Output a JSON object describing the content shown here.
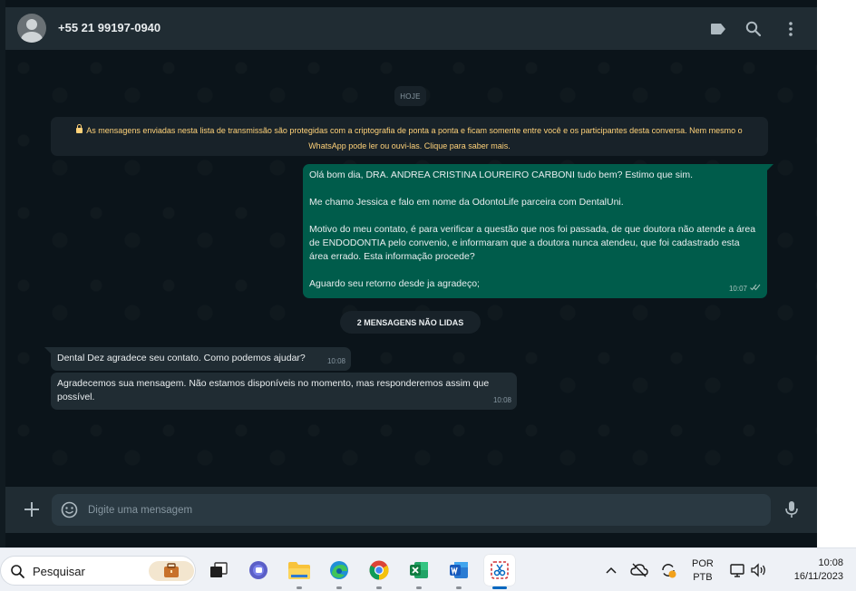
{
  "header": {
    "contact": "+55 21 99197-0940",
    "icons": [
      "label-icon",
      "search-icon",
      "menu-dots-icon"
    ]
  },
  "chat": {
    "date_divider": "HOJE",
    "encryption_notice": "As mensagens enviadas nesta lista de transmissão são protegidas com a criptografia de ponta a ponta e ficam somente entre você e os participantes desta conversa. Nem mesmo o WhatsApp pode ler ou ouvi-las. Clique para saber mais.",
    "outgoing": {
      "paragraphs": [
        "Olá bom dia, DRA. ANDREA CRISTINA LOUREIRO CARBONI tudo bem? Estimo que sim.",
        "Me chamo Jessica e falo em nome da OdontoLife parceira com DentalUni.",
        "Motivo do meu contato, é para verificar a questão que nos foi passada, de que doutora não atende a área de ENDODONTIA pelo convenio, e informaram que a doutora nunca atendeu, que foi cadastrado esta área errado. Esta informação procede?",
        "Aguardo seu retorno desde ja agradeço;"
      ],
      "time": "10:07",
      "status_icon": "double-check-icon"
    },
    "unread_divider": "2 MENSAGENS NÃO LIDAS",
    "incoming": [
      {
        "text": "Dental Dez agradece seu contato. Como podemos ajudar?",
        "time": "10:08"
      },
      {
        "text": "Agradecemos sua mensagem. Não estamos disponíveis no momento, mas responderemos assim que possível.",
        "time": "10:08"
      }
    ]
  },
  "composer": {
    "placeholder": "Digite uma mensagem",
    "icons": [
      "plus-icon",
      "emoji-icon",
      "mic-icon"
    ]
  },
  "taskbar": {
    "search_label": "Pesquisar",
    "apps": [
      "task-view-icon",
      "teams-icon",
      "file-explorer-icon",
      "edge-icon",
      "chrome-icon",
      "excel-icon",
      "word-icon",
      "snipping-tool-icon"
    ],
    "language": {
      "line1": "POR",
      "line2": "PTB"
    },
    "time": "10:08",
    "date": "16/11/2023"
  },
  "colors": {
    "chat_bg": "#0b141a",
    "header_bg": "#202c33",
    "outgoing_bubble": "#005c4b",
    "incoming_bubble": "#202c33",
    "notice_text": "#ffd279"
  }
}
